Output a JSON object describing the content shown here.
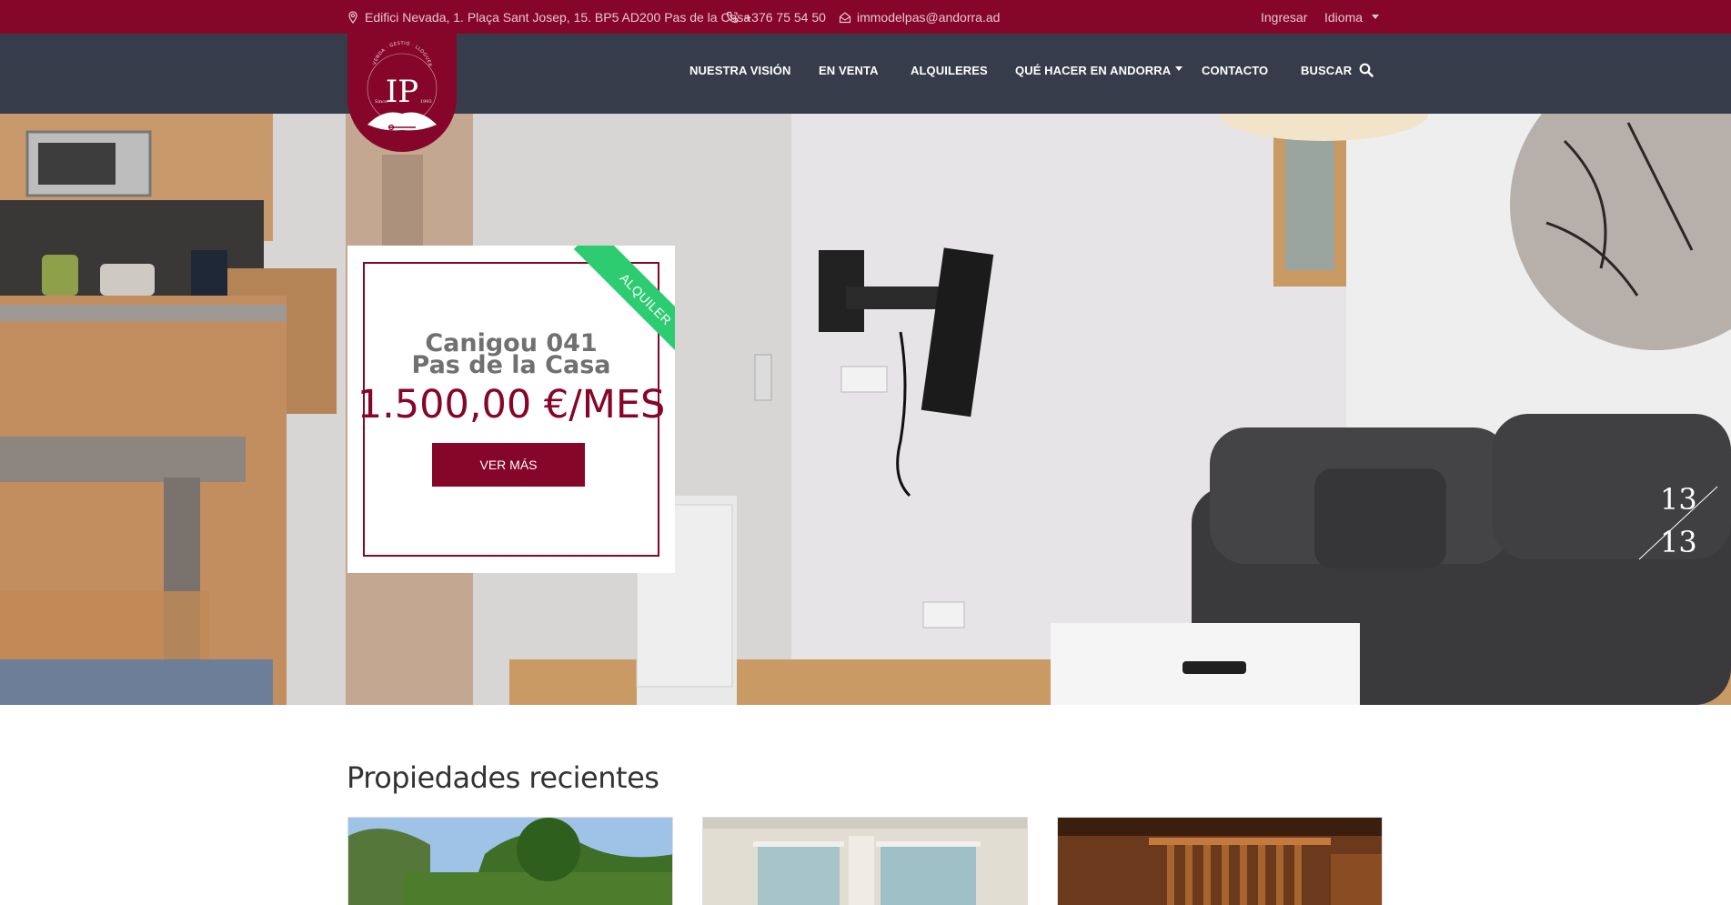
{
  "topbar": {
    "address": "Edifici Nevada, 1. Plaça Sant Josep, 15. BP5 AD200 Pas de la Casa",
    "address_icon": "map-pin-icon",
    "phone": "+376 75 54 50",
    "phone_icon": "phone-icon",
    "email": "immodelpas@andorra.ad",
    "email_icon": "home-mail-icon",
    "login": "Ingresar",
    "language": "Idioma"
  },
  "logo": {
    "letters": "IP",
    "arc_text": "VENDA · GESTIÓ · LLOGUER",
    "since_label": "Since",
    "since_year": "1993"
  },
  "nav": {
    "items": [
      {
        "label": "NUESTRA VISIÓN"
      },
      {
        "label": "EN VENTA"
      },
      {
        "label": "ALQUILERES"
      },
      {
        "label": "QUÉ HACER EN ANDORRA",
        "dropdown": true
      },
      {
        "label": "CONTACTO"
      },
      {
        "label": "BUSCAR",
        "icon": "search-icon"
      }
    ]
  },
  "hero": {
    "ribbon": "ALQUILER",
    "title_line1": "Canigou 041",
    "title_line2": "Pas de la Casa",
    "price": "1.500,00 €/MES",
    "button": "VER MÁS",
    "slide_current": "13",
    "slide_total": "13"
  },
  "recent": {
    "title": "Propiedades recientes"
  },
  "colors": {
    "brand": "#850628",
    "nav": "#363c4a",
    "ribbon": "#2ecc71"
  }
}
